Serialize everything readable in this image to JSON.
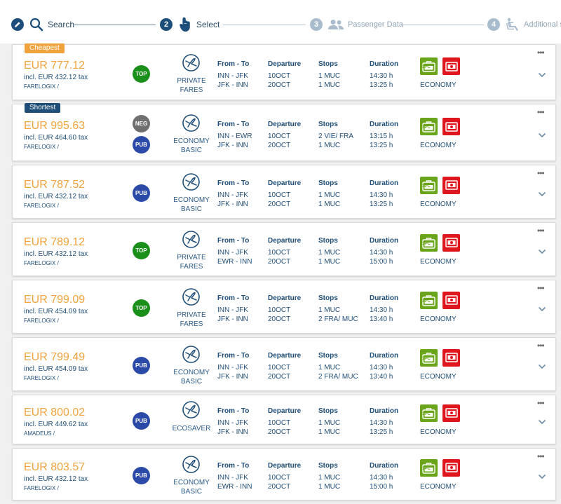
{
  "stepper": {
    "steps": [
      {
        "num": "",
        "label": "Search"
      },
      {
        "num": "2",
        "label": "Select"
      },
      {
        "num": "3",
        "label": "Passenger Data"
      },
      {
        "num": "4",
        "label": "Additional s"
      }
    ]
  },
  "colors": {
    "price": "#f0a33c",
    "primary": "#1f4e79",
    "top_badge": "#1a8f1a",
    "pub_badge": "#2b4aa8",
    "neg_badge": "#6f6f6f",
    "bag_green": "#6aa41a",
    "bag_red": "#e0161e"
  },
  "columns": {
    "route": "From - To",
    "departure": "Departure",
    "stops": "Stops",
    "duration": "Duration"
  },
  "offers": [
    {
      "tag": "Cheapest",
      "tag_type": "cheapest",
      "price": "EUR 777.12",
      "tax": "incl. EUR 432.12 tax",
      "source": "FARELOGIX /",
      "badges": [
        "TOP"
      ],
      "fare_lines": [
        "PRIVATE",
        "FARES"
      ],
      "routes": [
        "INN - JFK",
        "JFK - INN"
      ],
      "departures": [
        "10OCT",
        "20OCT"
      ],
      "stops": [
        "1 MUC",
        "1 MUC"
      ],
      "durations": [
        "14:30 h",
        "13:25 h"
      ],
      "bag_label": "1PC",
      "cabin": "ECONOMY"
    },
    {
      "tag": "Shortest",
      "tag_type": "shortest",
      "price": "EUR 995.63",
      "tax": "incl. EUR 464.60 tax",
      "source": "FARELOGIX /",
      "badges": [
        "NEG",
        "PUB"
      ],
      "fare_lines": [
        "ECONOMY",
        "BASIC"
      ],
      "routes": [
        "INN - EWR",
        "JFK - INN"
      ],
      "departures": [
        "10OCT",
        "20OCT"
      ],
      "stops": [
        "2 VIE/ FRA",
        "1 MUC"
      ],
      "durations": [
        "13:15 h",
        "13:25 h"
      ],
      "bag_label": "1PC",
      "cabin": "ECONOMY"
    },
    {
      "tag": "",
      "tag_type": "",
      "price": "EUR 787.52",
      "tax": "incl. EUR 432.12 tax",
      "source": "FARELOGIX /",
      "badges": [
        "PUB"
      ],
      "fare_lines": [
        "ECONOMY",
        "BASIC"
      ],
      "routes": [
        "INN - JFK",
        "JFK - INN"
      ],
      "departures": [
        "10OCT",
        "20OCT"
      ],
      "stops": [
        "1 MUC",
        "1 MUC"
      ],
      "durations": [
        "14:30 h",
        "13:25 h"
      ],
      "bag_label": "1PC",
      "cabin": "ECONOMY"
    },
    {
      "tag": "",
      "tag_type": "",
      "price": "EUR 789.12",
      "tax": "incl. EUR 432.12 tax",
      "source": "FARELOGIX /",
      "badges": [
        "TOP"
      ],
      "fare_lines": [
        "PRIVATE",
        "FARES"
      ],
      "routes": [
        "INN - JFK",
        "EWR - INN"
      ],
      "departures": [
        "10OCT",
        "20OCT"
      ],
      "stops": [
        "1 MUC",
        "1 MUC"
      ],
      "durations": [
        "14:30 h",
        "15:00 h"
      ],
      "bag_label": "1PC",
      "cabin": "ECONOMY"
    },
    {
      "tag": "",
      "tag_type": "",
      "price": "EUR 799.09",
      "tax": "incl. EUR 454.09 tax",
      "source": "FARELOGIX /",
      "badges": [
        "TOP"
      ],
      "fare_lines": [
        "PRIVATE",
        "FARES"
      ],
      "routes": [
        "INN - JFK",
        "JFK - INN"
      ],
      "departures": [
        "10OCT",
        "20OCT"
      ],
      "stops": [
        "1 MUC",
        "2 FRA/ MUC"
      ],
      "durations": [
        "14:30 h",
        "13:40 h"
      ],
      "bag_label": "1PC",
      "cabin": "ECONOMY"
    },
    {
      "tag": "",
      "tag_type": "",
      "price": "EUR 799.49",
      "tax": "incl. EUR 454.09 tax",
      "source": "FARELOGIX /",
      "badges": [
        "PUB"
      ],
      "fare_lines": [
        "ECONOMY",
        "BASIC"
      ],
      "routes": [
        "INN - JFK",
        "JFK - INN"
      ],
      "departures": [
        "10OCT",
        "20OCT"
      ],
      "stops": [
        "1 MUC",
        "2 FRA/ MUC"
      ],
      "durations": [
        "14:30 h",
        "13:40 h"
      ],
      "bag_label": "1PC",
      "cabin": "ECONOMY"
    },
    {
      "tag": "",
      "tag_type": "",
      "price": "EUR 800.02",
      "tax": "incl. EUR 449.62 tax",
      "source": "AMADEUS /",
      "badges": [
        "PUB"
      ],
      "fare_lines": [
        "ECOSAVER"
      ],
      "routes": [
        "INN - JFK",
        "JFK - INN"
      ],
      "departures": [
        "10OCT",
        "20OCT"
      ],
      "stops": [
        "1 MUC",
        "1 MUC"
      ],
      "durations": [
        "14:30 h",
        "13:25 h"
      ],
      "bag_label": "1PC",
      "cabin": "ECONOMY"
    },
    {
      "tag": "",
      "tag_type": "",
      "price": "EUR 803.57",
      "tax": "incl. EUR 432.12 tax",
      "source": "FARELOGIX /",
      "badges": [
        "PUB"
      ],
      "fare_lines": [
        "ECONOMY",
        "BASIC"
      ],
      "routes": [
        "INN - JFK",
        "EWR - INN"
      ],
      "departures": [
        "10OCT",
        "20OCT"
      ],
      "stops": [
        "1 MUC",
        "1 MUC"
      ],
      "durations": [
        "14:30 h",
        "15:00 h"
      ],
      "bag_label": "1PC",
      "cabin": "ECONOMY"
    }
  ]
}
